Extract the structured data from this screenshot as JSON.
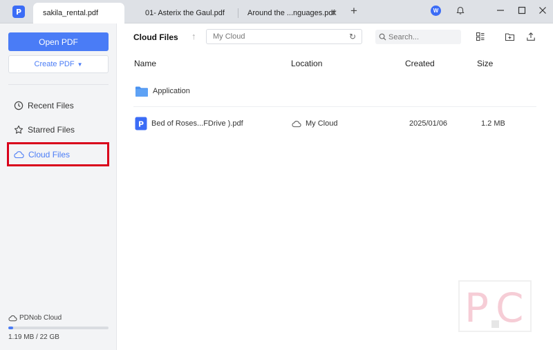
{
  "tabs": [
    {
      "title": "sakila_rental.pdf",
      "active": true
    },
    {
      "title": "01- Asterix the Gaul.pdf",
      "active": false
    },
    {
      "title": "Around the ...nguages.pdf",
      "active": false
    }
  ],
  "titlebar": {
    "app_logo": "P",
    "new_tab": "+",
    "avatar": "W",
    "icons": [
      "bell-icon",
      "minimize-icon",
      "maximize-icon",
      "close-icon"
    ]
  },
  "sidebar": {
    "open_pdf": "Open PDF",
    "create_pdf": "Create PDF",
    "nav": [
      {
        "label": "Recent Files",
        "icon": "clock-icon",
        "active": false
      },
      {
        "label": "Starred Files",
        "icon": "star-icon",
        "active": false
      },
      {
        "label": "Cloud Files",
        "icon": "cloud-icon",
        "active": true
      }
    ],
    "storage": {
      "label": "PDNob Cloud",
      "usage": "1.19 MB  /  22 GB",
      "used_fraction": 0.05
    }
  },
  "main": {
    "title": "Cloud Files",
    "path": "My Cloud",
    "search_placeholder": "Search...",
    "columns": {
      "name": "Name",
      "location": "Location",
      "created": "Created",
      "size": "Size"
    },
    "rows": [
      {
        "type": "folder",
        "name": "Application",
        "location": "",
        "created": "",
        "size": ""
      },
      {
        "type": "pdf",
        "name": "Bed of Roses...FDrive ).pdf",
        "location": "My Cloud",
        "created": "2025/01/06",
        "size": "1.2 MB"
      }
    ]
  },
  "colors": {
    "accent": "#4a7cf6",
    "highlight_box": "#d9001b",
    "sidebar_bg": "#f3f4f6"
  }
}
